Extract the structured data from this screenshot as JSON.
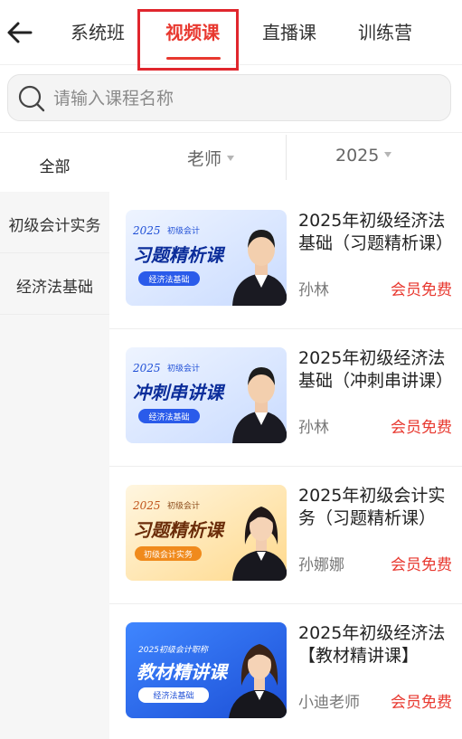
{
  "header": {
    "back_icon": "arrow-left-icon",
    "tabs": [
      {
        "label": "系统班",
        "active": false
      },
      {
        "label": "视频课",
        "active": true
      },
      {
        "label": "直播课",
        "active": false
      },
      {
        "label": "训练营",
        "active": false
      }
    ]
  },
  "search": {
    "placeholder": "请输入课程名称",
    "icon": "search-icon"
  },
  "filters": {
    "all_label": "全部",
    "teacher_label": "老师",
    "year_label": "2025"
  },
  "sidebar": {
    "items": [
      {
        "label": "初级会计实务"
      },
      {
        "label": "经济法基础"
      }
    ]
  },
  "courses": [
    {
      "title": "2025年初级经济法基础（习题精析课）",
      "teacher": "孙林",
      "price": "会员免费",
      "thumb": {
        "year": "2025",
        "tag": "初级会计",
        "headline": "习题精析课",
        "badge": "经济法基础",
        "theme": "blue"
      }
    },
    {
      "title": "2025年初级经济法基础（冲刺串讲课）",
      "teacher": "孙林",
      "price": "会员免费",
      "thumb": {
        "year": "2025",
        "tag": "初级会计",
        "headline": "冲刺串讲课",
        "badge": "经济法基础",
        "theme": "blue"
      }
    },
    {
      "title": "2025年初级会计实务（习题精析课）",
      "teacher": "孙娜娜",
      "price": "会员免费",
      "thumb": {
        "year": "2025",
        "tag": "初级会计",
        "headline": "习题精析课",
        "badge": "初级会计实务",
        "theme": "orange"
      }
    },
    {
      "title": "2025年初级经济法【教材精讲课】",
      "teacher": "小迪老师",
      "price": "会员免费",
      "thumb": {
        "year": "2025",
        "tag": "初级会计职称",
        "headline": "教材精讲课",
        "badge": "经济法基础",
        "theme": "deepblue"
      }
    }
  ],
  "colors": {
    "accent": "#e8382f",
    "blue_thumb": "#dfe9ff",
    "orange_thumb": "#ffe7b8",
    "deepblue_thumb": "#2f6cf0"
  }
}
